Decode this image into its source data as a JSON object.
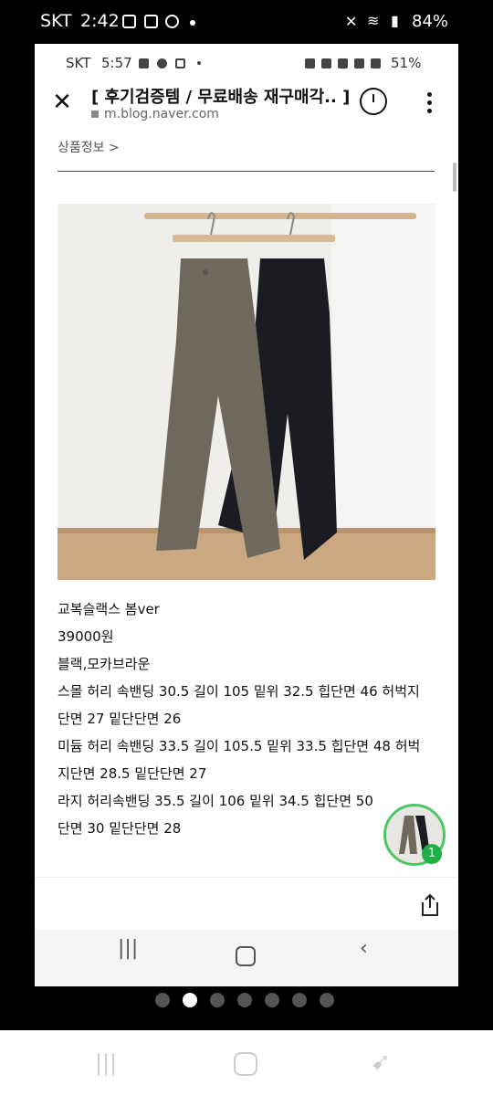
{
  "outer_status": {
    "carrier": "SKT",
    "time": "2:42",
    "battery": "84%"
  },
  "inner_status": {
    "carrier": "SKT",
    "time": "5:57",
    "battery": "51%"
  },
  "header": {
    "title": "[ 후기검증템 / 무료배송 재구매각.. ]",
    "url": "m.blog.naver.com"
  },
  "section": {
    "label": "상품정보 >"
  },
  "product": {
    "lines": [
      "교복슬랙스 봄ver",
      "39000원",
      "블랙,모카브라운",
      "스몰 허리 속밴딩 30.5 길이 105 밑위 32.5 힙단면 46 허벅지",
      "단면 27 밑단단면 26",
      "미듐 허리 속밴딩 33.5 길이 105.5 밑위 33.5 힙단면 48 허벅",
      "지단면 28.5 밑단단면 27",
      "라지 허리속밴딩 35.5 길이 106 밑위 34.5 힙단면 50",
      "단면 30 밑단단면 28"
    ]
  },
  "floating": {
    "badge": "1"
  },
  "icons": {
    "close": "close-icon",
    "history": "history-icon",
    "more": "more-icon",
    "share": "share-icon",
    "lock": "lock-icon"
  },
  "colors": {
    "accent_green": "#1fb043"
  }
}
